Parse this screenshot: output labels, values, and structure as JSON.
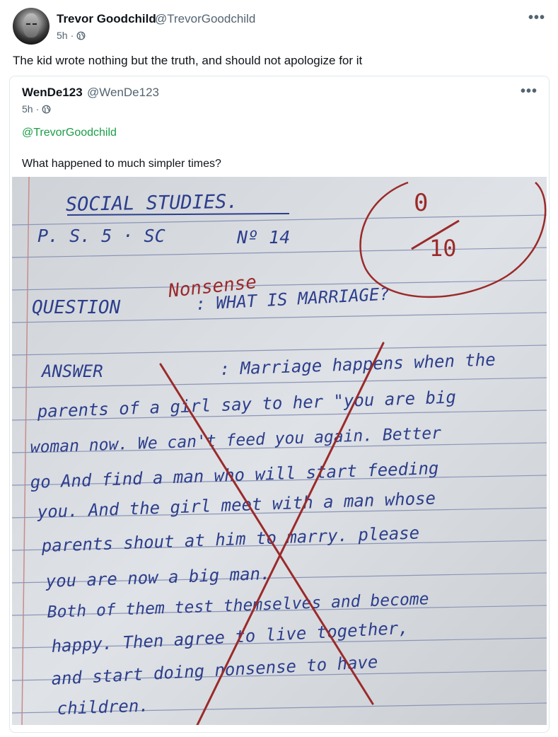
{
  "post": {
    "author_name": "Trevor Goodchild",
    "author_handle": "@TrevorGoodchild",
    "time": "5h",
    "separator": "·",
    "more": "•••",
    "text": "The kid wrote nothing but the truth, and should not apologize for it"
  },
  "quoted": {
    "author_name": "WenDe123",
    "author_handle": "@WenDe123",
    "time": "5h",
    "separator": "·",
    "more": "•••",
    "mention": "@TrevorGoodchild",
    "text": "What happened to much simpler times?",
    "image": {
      "heading": "SOCIAL STUDIES.",
      "class_line": "P. S. 5 · SC",
      "number": "Nº 14",
      "score_top": "0",
      "score_bottom": "10",
      "teacher_note": "Nonsense",
      "question_label": "QUESTION",
      "question_text": ": WHAT IS MARRIAGE?",
      "answer_label": "ANSWER",
      "answer_lines": [
        ": Marriage happens when the",
        "parents of a girl say to her \"you are big",
        "woman now. We can't feed you again. Better",
        "go And find a man who will start feeding",
        "you. And the girl meet with a man whose",
        "parents shout at him to marry. please",
        "you are now a big man.",
        "Both of them test themselves and become",
        "happy. Then agree to live together,",
        "and start doing nonsense to have",
        "children."
      ]
    }
  },
  "colors": {
    "accent_green": "#1a9d47",
    "ink_blue": "#2c3e8c",
    "pen_red": "#9b2a2a",
    "paper": "#d9dde2"
  }
}
